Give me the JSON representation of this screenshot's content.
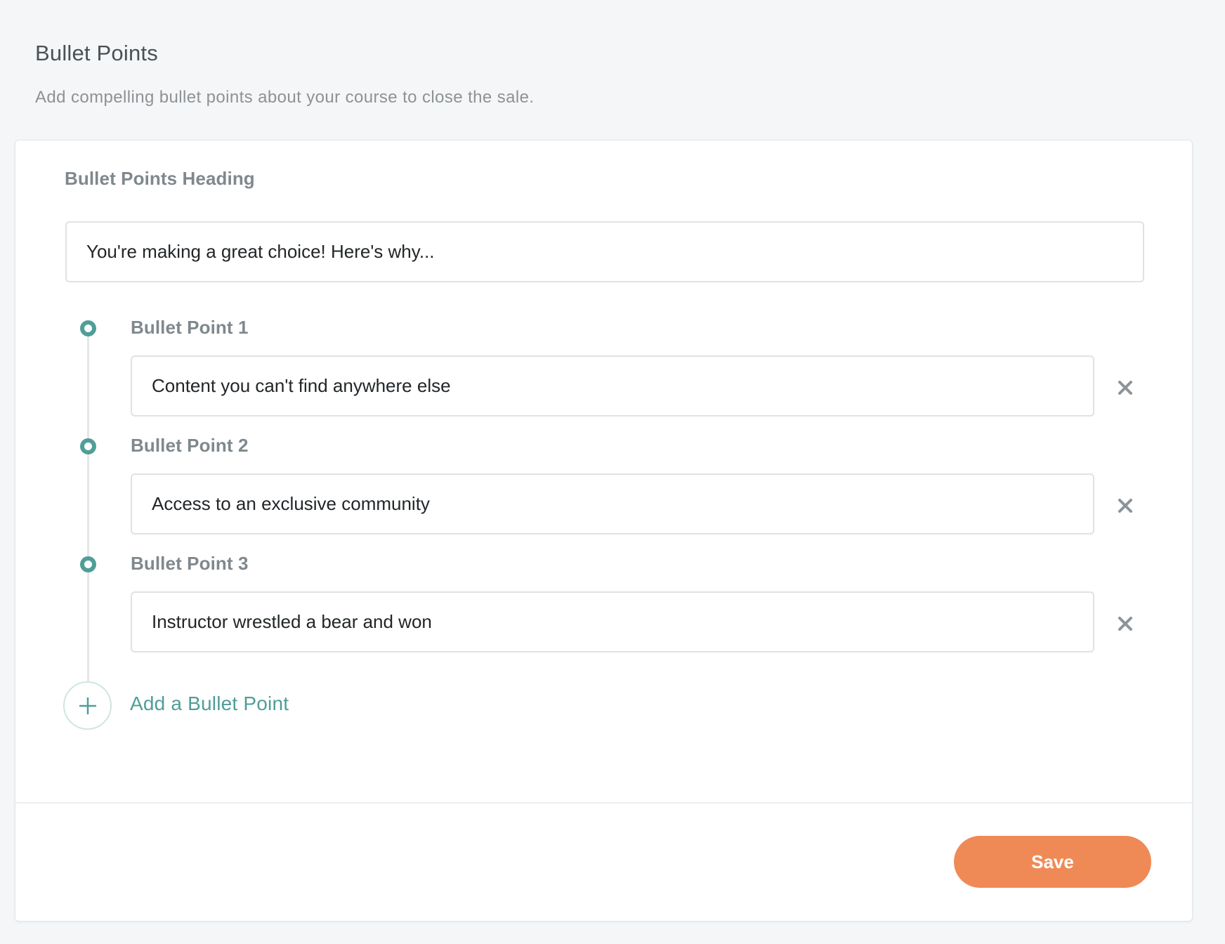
{
  "section": {
    "title": "Bullet Points",
    "description": "Add compelling bullet points about your course to close the sale."
  },
  "heading_field": {
    "label": "Bullet Points Heading",
    "value": "You're making a great choice! Here's why..."
  },
  "bullets": [
    {
      "label": "Bullet Point 1",
      "value": "Content you can't find anywhere else",
      "remove_icon": "close-icon"
    },
    {
      "label": "Bullet Point 2",
      "value": "Access to an exclusive community",
      "remove_icon": "close-icon"
    },
    {
      "label": "Bullet Point 3",
      "value": "Instructor wrestled a bear and won",
      "remove_icon": "close-icon"
    }
  ],
  "add_bullet": {
    "label": "Add a Bullet Point",
    "icon": "plus-icon"
  },
  "footer": {
    "save_label": "Save"
  },
  "colors": {
    "accent_teal": "#4f9e97",
    "save_orange": "#ef8a56",
    "page_background": "#f5f6f7"
  }
}
